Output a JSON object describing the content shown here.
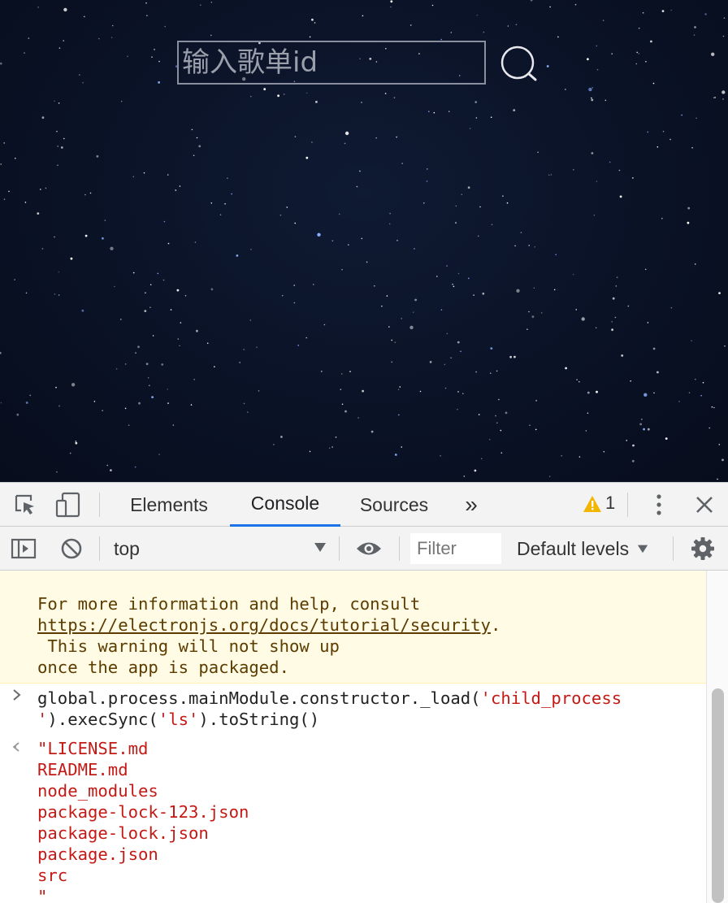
{
  "app": {
    "search_placeholder": "输入歌单id",
    "search_icon": "search-icon"
  },
  "devtools": {
    "tabs": {
      "inspect_icon": "inspect-element-icon",
      "device_icon": "device-toolbar-icon",
      "elements": "Elements",
      "console": "Console",
      "sources": "Sources",
      "more": "»",
      "warning_count": "1",
      "kebab_icon": "more-options-icon",
      "close_icon": "close-icon"
    },
    "toolbar": {
      "sidebar_icon": "console-sidebar-icon",
      "clear_icon": "clear-console-icon",
      "context": "top",
      "eye_icon": "live-expression-icon",
      "filter_placeholder": "Filter",
      "levels": "Default levels",
      "settings_icon": "gear-icon"
    },
    "colors": {
      "active_tab": "#1a73e8",
      "warning_bg": "#fffbe5",
      "string": "#c41a16"
    },
    "console": {
      "warning_lines": [
        "For more information and help, consult",
        "https://electronjs.org/docs/tutorial/security",
        " This warning will not show up",
        "once the app is packaged."
      ],
      "warning_link_suffix": ".",
      "input_prefix": "global.process.mainModule.constructor._load(",
      "input_string_1": "'child_process",
      "input_string_2": "'",
      "input_suffix_2": ").execSync(",
      "input_string_3": "'ls'",
      "input_suffix_3": ").toString()",
      "output_lines": [
        "\"LICENSE.md",
        "README.md",
        "node_modules",
        "package-lock-123.json",
        "package-lock.json",
        "package.json",
        "src",
        "\""
      ]
    }
  }
}
